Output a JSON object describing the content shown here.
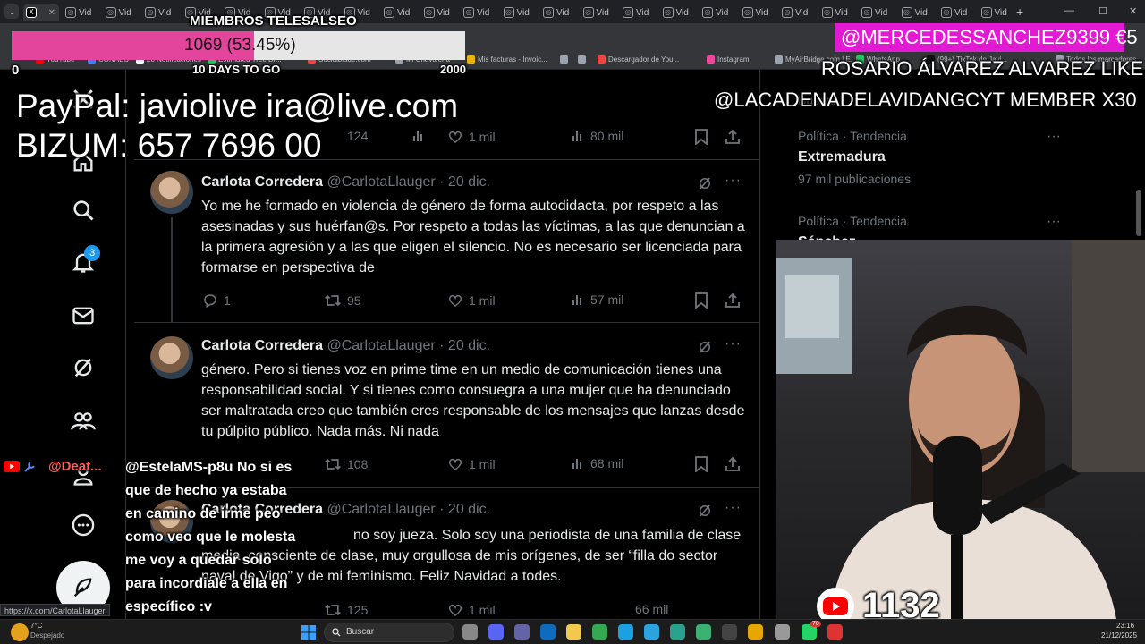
{
  "browser": {
    "tab_label": "Vid",
    "active_tab_icon": "X",
    "bookmarks": [
      {
        "label": "YouTube",
        "color": "#ff0000"
      },
      {
        "label": "CONAES",
        "color": "#3b82f6"
      },
      {
        "label": "20 Notificaciones",
        "color": "#ffffff"
      },
      {
        "label": "Estimated Tree Dr...",
        "color": "#22c55e"
      },
      {
        "label": "Socialblade.com",
        "color": "#ef4444"
      },
      {
        "label": "Mi Chavaleria",
        "color": "#9ca3af"
      },
      {
        "label": "Mis facturas - Invoic...",
        "color": "#eab308"
      },
      {
        "label": "",
        "color": "#9ca3af"
      },
      {
        "label": "",
        "color": "#9ca3af"
      },
      {
        "label": "Descargador de You...",
        "color": "#ef4444"
      },
      {
        "label": "Instagram",
        "color": "#ec4899"
      },
      {
        "label": "MyAirBridge.com | E...",
        "color": "#9ca3af"
      },
      {
        "label": "WhatsApp",
        "color": "#22c55e"
      },
      {
        "label": "(99+) TikTok de Javi...",
        "color": "#111111"
      },
      {
        "label": "Todos los marcadores",
        "color": "#9ca3af"
      }
    ],
    "status_url": "https://x.com/CarlotaLlauger"
  },
  "x": {
    "nav_badge": "3",
    "top_stats": {
      "replies": "124",
      "likes": "1 mil",
      "views": "80 mil"
    },
    "tweets": [
      {
        "name": "Carlota Corredera",
        "handle": "@CarlotaLlauger · 20 dic.",
        "text": "Yo me he formado en violencia de género de forma autodidacta, por respeto a las asesinadas y sus huérfan@s. Por respeto a todas las víctimas, a las que denuncian a la primera agresión y a las que eligen el silencio. No es necesario ser licenciada para formarse en perspectiva de",
        "replies": "1",
        "retweets": "95",
        "likes": "1 mil",
        "views": "57 mil"
      },
      {
        "name": "Carlota Corredera",
        "handle": "@CarlotaLlauger · 20 dic.",
        "text": "género. Pero si tienes voz en prime time en un medio de comunicación tienes una responsabilidad social. Y si tienes como consuegra a una mujer que ha denunciado ser maltratada creo que también eres responsable de los mensajes que lanzas desde tu púlpito público. Nada más. Ni nada",
        "replies": "",
        "retweets": "108",
        "likes": "1 mil",
        "views": "68 mil"
      },
      {
        "name": "Carlota Corredera",
        "handle": "@CarlotaLlauger · 20 dic.",
        "text": "no soy jueza. Solo soy una periodista de una familia de clase media, consciente de clase, muy orgullosa de mis orígenes, de ser “filla do sector naval de Vigo” y de mi feminismo. Feliz Navidad a todes.",
        "replies": "",
        "retweets": "125",
        "likes": "1 mil",
        "views": "66 mil"
      }
    ],
    "search_placeholder": "Buscar",
    "trends": [
      {
        "meta": "Política · Tendencia",
        "title": "Extremadura",
        "count": "97 mil publicaciones"
      },
      {
        "meta": "Política · Tendencia",
        "title": "Sánchez",
        "count": ""
      }
    ]
  },
  "overlay": {
    "goal_title": "MIEMBROS TELESALSEO",
    "goal_value": "1069 (53.45%)",
    "goal_fraction": 0.5345,
    "goal_min": "0",
    "goal_max": "2000",
    "goal_days": "10 DAYS TO GO",
    "paypal": "PayPal: javiolive ira@live.com",
    "bizum": "BIZUM: 657 7696 00",
    "donation": "@MERCEDESSANCHEZ9399  €5",
    "alert_line1": "ROSARIO ÁLVAREZ ALVAREZ  LIKE",
    "alert_line2": "@LACADENADELAVIDANGCYT  MEMBER X30",
    "chat_user": "@Deat...",
    "chat_message": "@EstelaMS-p8u No si es que de hecho ya estaba en camino de irme peo como veo que le molesta me voy a quedar solo para incordiale a ella en específico :v",
    "viewers": "1132"
  },
  "taskbar": {
    "weather_temp": "7°C",
    "weather_desc": "Despejado",
    "search": "Buscar",
    "time": "23:16",
    "date": "21/12/2025",
    "notif_badge": "70"
  }
}
